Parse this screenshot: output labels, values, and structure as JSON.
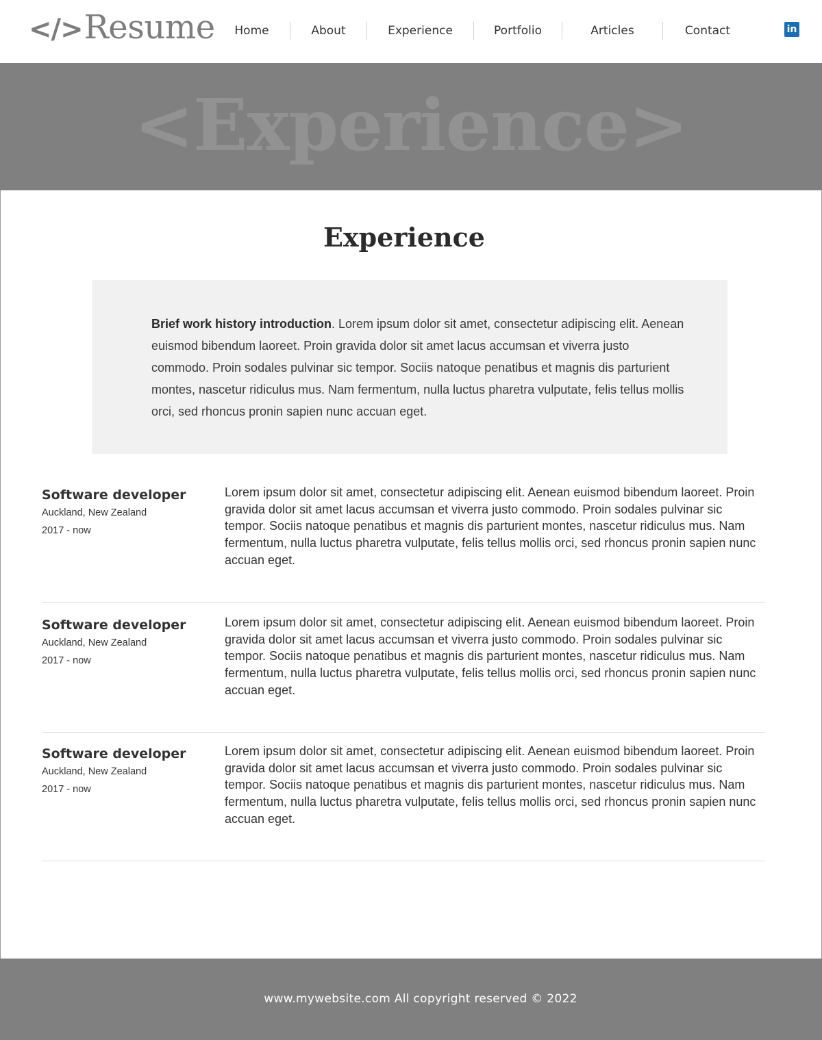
{
  "header": {
    "logo_mark": "</>",
    "logo_text": "Resume",
    "nav": [
      "Home",
      "About",
      "Experience",
      "Portfolio",
      "Articles",
      "Contact"
    ],
    "social_icon": "linkedin-icon",
    "social_glyph": "in"
  },
  "banner": {
    "text": "<Experience>"
  },
  "main": {
    "title": "Experience",
    "intro": {
      "bold": "Brief work history introduction",
      "text": ". Lorem ipsum dolor sit amet, consectetur adipiscing elit. Aenean euismod bibendum laoreet. Proin gravida dolor sit amet lacus accumsan et viverra justo commodo. Proin sodales pulvinar sic tempor. Sociis natoque penatibus et magnis dis parturient montes, nascetur ridiculus mus. Nam fermentum, nulla luctus pharetra vulputate, felis tellus mollis orci, sed rhoncus pronin sapien nunc accuan eget."
    },
    "entries": [
      {
        "title": "Software developer",
        "location": "Auckland, New Zealand",
        "dates": "2017 - now",
        "description": "Lorem ipsum dolor sit amet, consectetur adipiscing elit. Aenean euismod bibendum laoreet. Proin gravida dolor sit amet lacus accumsan et viverra justo commodo. Proin sodales pulvinar sic tempor. Sociis natoque penatibus et magnis dis parturient montes, nascetur ridiculus mus. Nam fermentum, nulla luctus pharetra vulputate, felis tellus mollis orci, sed rhoncus pronin sapien nunc accuan eget."
      },
      {
        "title": "Software developer",
        "location": "Auckland, New Zealand",
        "dates": "2017 - now",
        "description": "Lorem ipsum dolor sit amet, consectetur adipiscing elit. Aenean euismod bibendum laoreet. Proin gravida dolor sit amet lacus accumsan et viverra justo commodo. Proin sodales pulvinar sic tempor. Sociis natoque penatibus et magnis dis parturient montes, nascetur ridiculus mus. Nam fermentum, nulla luctus pharetra vulputate, felis tellus mollis orci, sed rhoncus pronin sapien nunc accuan eget."
      },
      {
        "title": "Software developer",
        "location": "Auckland, New Zealand",
        "dates": "2017 - now",
        "description": "Lorem ipsum dolor sit amet, consectetur adipiscing elit. Aenean euismod bibendum laoreet. Proin gravida dolor sit amet lacus accumsan et viverra justo commodo. Proin sodales pulvinar sic tempor. Sociis natoque penatibus et magnis dis parturient montes, nascetur ridiculus mus. Nam fermentum, nulla luctus pharetra vulputate, felis tellus mollis orci, sed rhoncus pronin sapien nunc accuan eget."
      }
    ]
  },
  "footer": {
    "text": "www.mywebsite.com All copyright reserved © 2022"
  },
  "colors": {
    "banner_bg": "#808080",
    "footer_bg": "#808080",
    "intro_bg": "#f1f1f1",
    "linkedin": "#1a6fb2",
    "logo": "#7d7d7d"
  }
}
